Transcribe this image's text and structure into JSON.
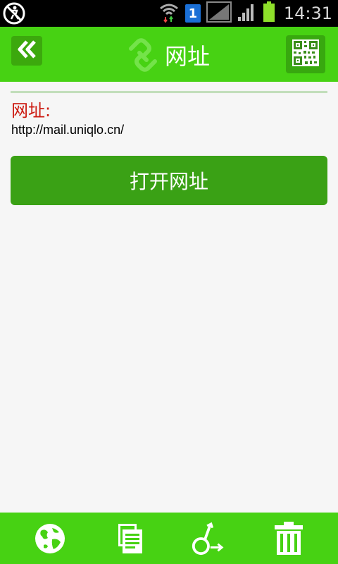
{
  "status_bar": {
    "time": "14:31",
    "sim_slot": "1"
  },
  "header": {
    "title": "网址"
  },
  "content": {
    "label": "网址:",
    "url": "http://mail.uniqlo.cn/",
    "open_button": "打开网址"
  },
  "colors": {
    "header_green": "#47d213",
    "button_green": "#3aa115",
    "label_red": "#cc1a10"
  },
  "bottom_bar": {
    "icons": [
      "globe-icon",
      "copy-icon",
      "share-icon",
      "trash-icon"
    ]
  }
}
